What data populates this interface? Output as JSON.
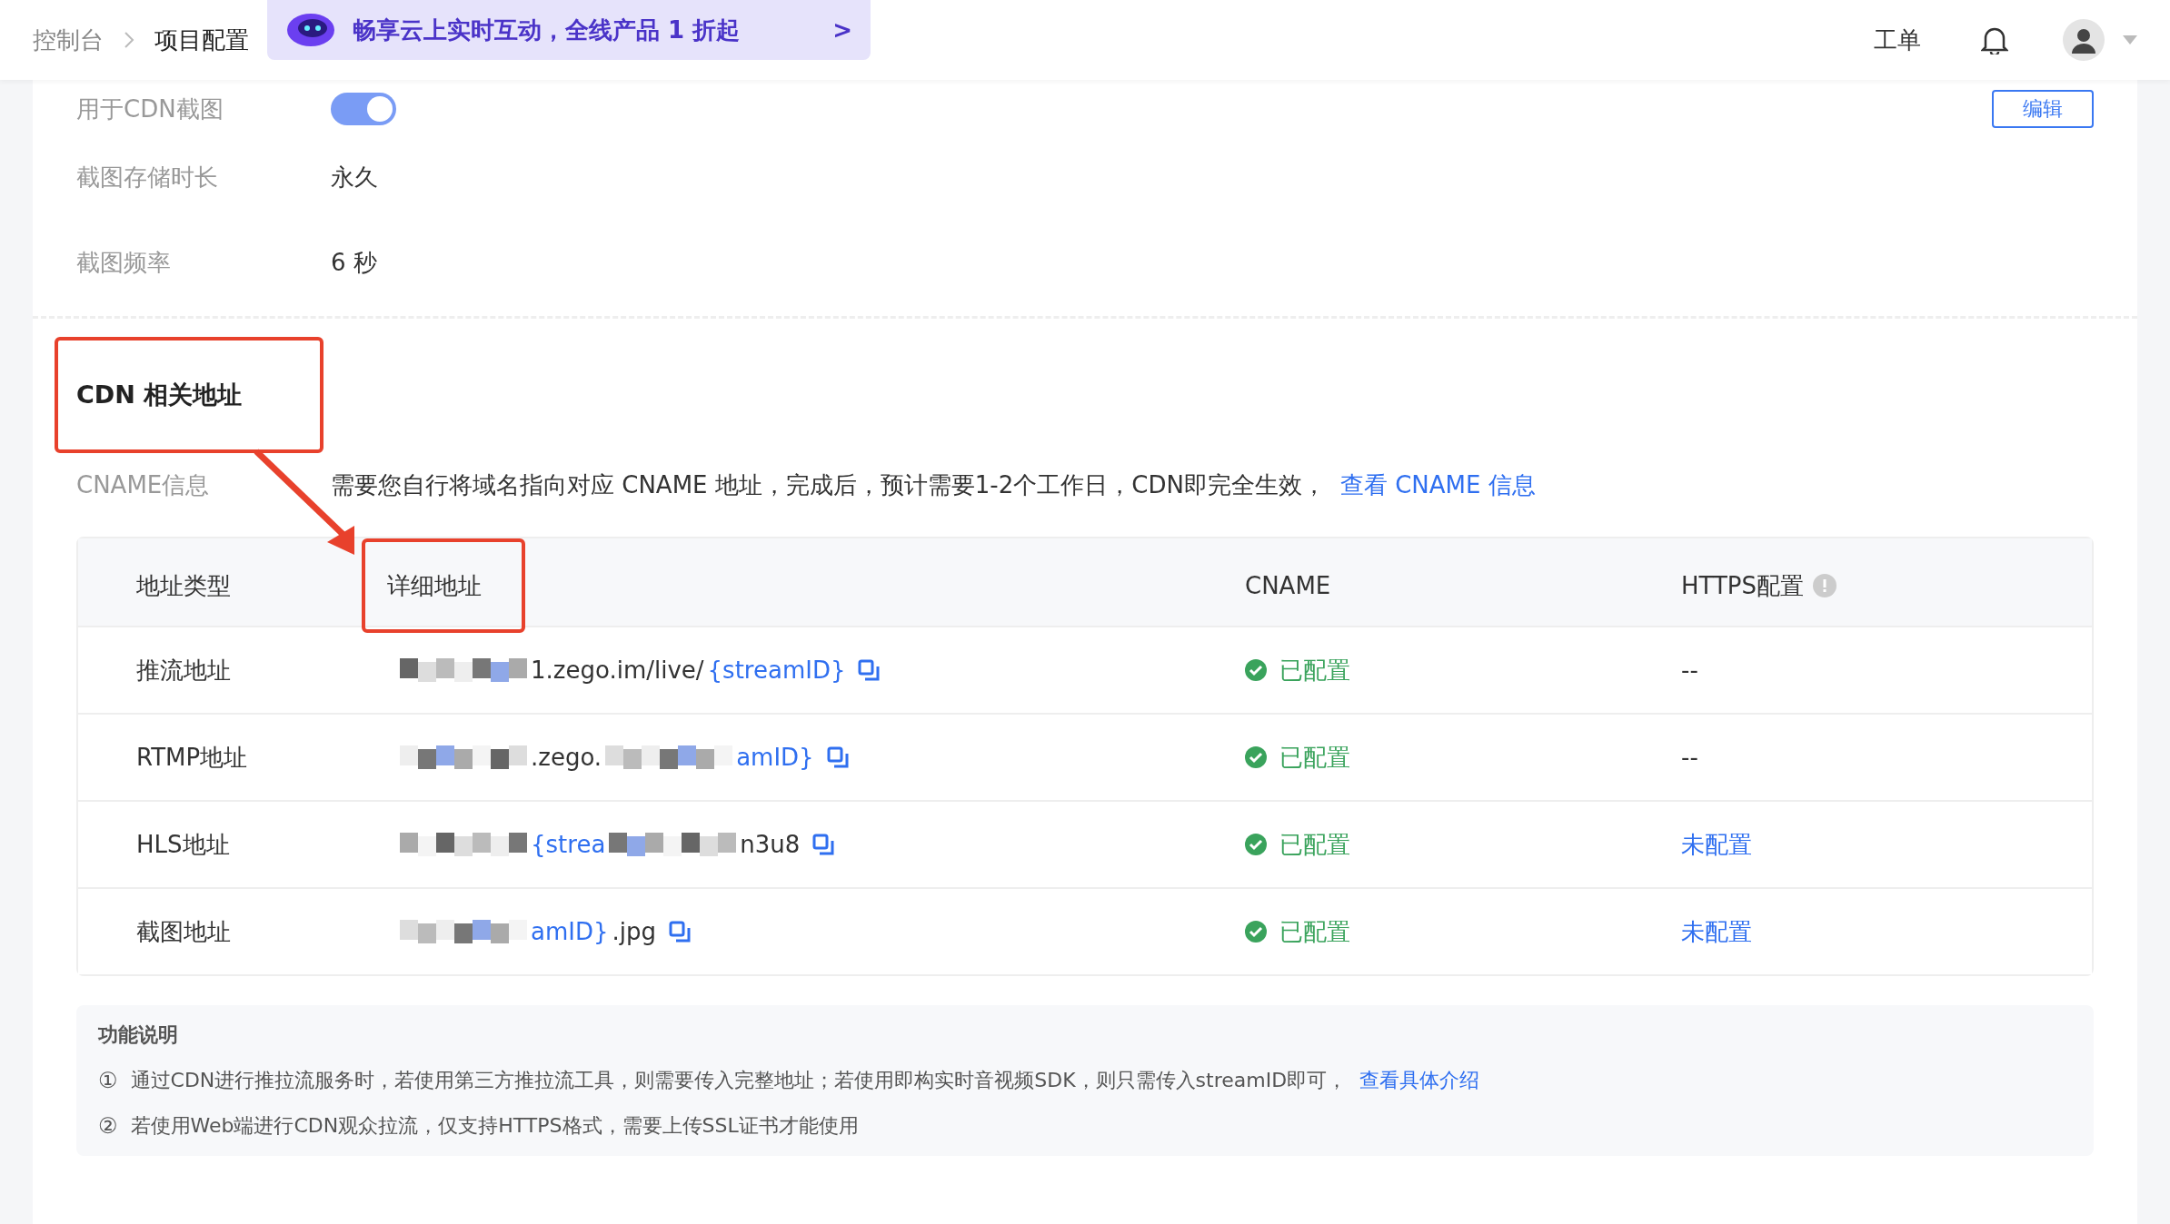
{
  "breadcrumb": [
    {
      "label": "控制台",
      "selected": false
    },
    {
      "label": "项目配置",
      "selected": true
    }
  ],
  "promo_banner": {
    "text": "畅享云上实时互动，全线产品 1 折起",
    "arrow": ">"
  },
  "header_actions": {
    "ticket": "工单"
  },
  "settings": [
    {
      "kind": "toggle",
      "label": "用于CDN截图",
      "on": true
    },
    {
      "kind": "text",
      "label": "截图存储时长",
      "value": "永久"
    },
    {
      "kind": "text",
      "label": "截图频率",
      "value": "6 秒"
    }
  ],
  "edit_button": "编辑",
  "cdn_section": {
    "title": "CDN 相关地址",
    "cname_label": "CNAME信息",
    "cname_text": "需要您自行将域名指向对应 CNAME 地址，完成后，预计需要1-2个工作日，CDN即完全生效，",
    "cname_link": "查看 CNAME 信息"
  },
  "table": {
    "columns": [
      "地址类型",
      "详细地址",
      "CNAME",
      "HTTPS配置"
    ],
    "rows": [
      {
        "type": "推流地址",
        "address": [
          {
            "kind": "mosaic"
          },
          {
            "kind": "text",
            "text": "1.zego.im/live/"
          },
          {
            "kind": "link",
            "text": "{streamID}"
          }
        ],
        "cname": "已配置",
        "https": {
          "kind": "text",
          "text": "--"
        }
      },
      {
        "type": "RTMP地址",
        "address": [
          {
            "kind": "mosaic"
          },
          {
            "kind": "text",
            "text": ".zego."
          },
          {
            "kind": "mosaic"
          },
          {
            "kind": "link",
            "text": "amID}"
          }
        ],
        "cname": "已配置",
        "https": {
          "kind": "text",
          "text": "--"
        }
      },
      {
        "type": "HLS地址",
        "address": [
          {
            "kind": "mosaic"
          },
          {
            "kind": "link",
            "text": "{strea"
          },
          {
            "kind": "mosaic"
          },
          {
            "kind": "text",
            "text": "n3u8"
          }
        ],
        "cname": "已配置",
        "https": {
          "kind": "link",
          "text": "未配置"
        }
      },
      {
        "type": "截图地址",
        "address": [
          {
            "kind": "mosaic"
          },
          {
            "kind": "link",
            "text": "amID}"
          },
          {
            "kind": "text",
            "text": ".jpg"
          }
        ],
        "cname": "已配置",
        "https": {
          "kind": "link",
          "text": "未配置"
        }
      }
    ]
  },
  "notes": {
    "title": "功能说明",
    "items": [
      {
        "mark": "①",
        "text": "通过CDN进行推拉流服务时，若使用第三方推拉流工具，则需要传入完整地址；若使用即构实时音视频SDK，则只需传入streamID即可，",
        "link": "查看具体介绍"
      },
      {
        "mark": "②",
        "text": "若使用Web端进行CDN观众拉流，仅支持HTTPS格式，需要上传SSL证书才能使用"
      }
    ]
  }
}
